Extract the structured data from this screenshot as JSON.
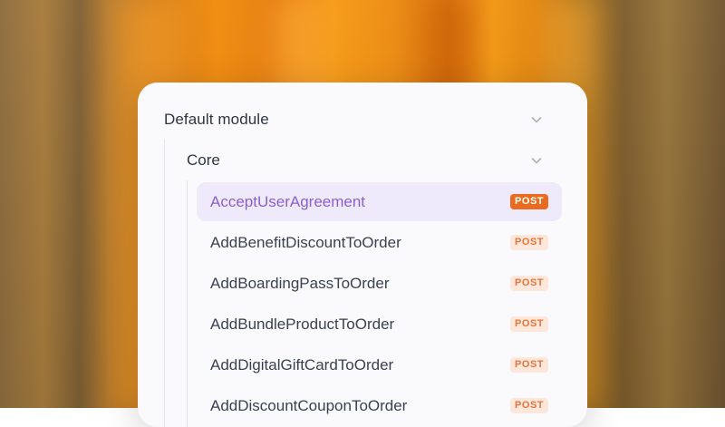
{
  "colors": {
    "accent_purple": "#8a5fd6",
    "selected_bg": "#efeafb",
    "post_badge_active_bg": "#ea6a1e",
    "post_badge_bg": "#fde7da",
    "post_badge_text": "#e1763f"
  },
  "tree": {
    "module": {
      "label": "Default module",
      "expanded": true,
      "toggle_icon": "chevron-down-icon"
    },
    "group": {
      "label": "Core",
      "expanded": true,
      "toggle_icon": "chevron-down-icon"
    },
    "endpoints": [
      {
        "name": "AcceptUserAgreement",
        "method": "POST",
        "selected": true
      },
      {
        "name": "AddBenefitDiscountToOrder",
        "method": "POST",
        "selected": false
      },
      {
        "name": "AddBoardingPassToOrder",
        "method": "POST",
        "selected": false
      },
      {
        "name": "AddBundleProductToOrder",
        "method": "POST",
        "selected": false
      },
      {
        "name": "AddDigitalGiftCardToOrder",
        "method": "POST",
        "selected": false
      },
      {
        "name": "AddDiscountCouponToOrder",
        "method": "POST",
        "selected": false
      }
    ]
  }
}
